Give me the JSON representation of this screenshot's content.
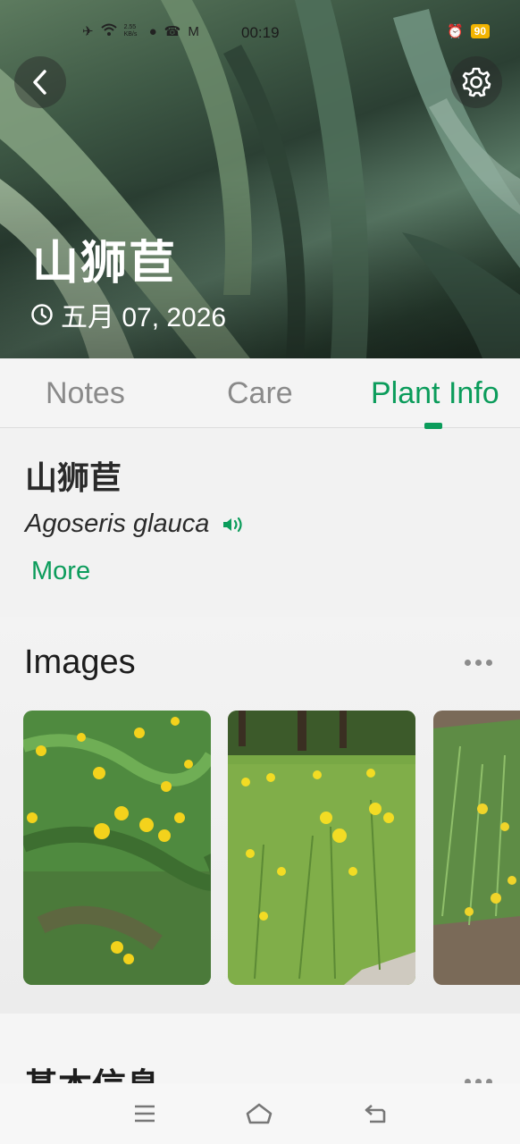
{
  "status_bar": {
    "time": "00:19",
    "net_speed": "2.55 KB/s",
    "battery": "90"
  },
  "header": {
    "back_icon": "chevron-left-icon",
    "settings_icon": "gear-icon",
    "plant_name": "山狮苣",
    "date": "五月 07, 2026"
  },
  "tabs": [
    {
      "label": "Notes",
      "active": false
    },
    {
      "label": "Care",
      "active": false
    },
    {
      "label": "Plant Info",
      "active": true
    }
  ],
  "plant_info": {
    "common_name": "山狮苣",
    "scientific_name": "Agoseris glauca",
    "more_label": "More"
  },
  "images_section": {
    "title": "Images"
  },
  "basic_info_section": {
    "title": "基本信息"
  },
  "colors": {
    "accent": "#0b9c5b",
    "battery": "#f2b400"
  }
}
